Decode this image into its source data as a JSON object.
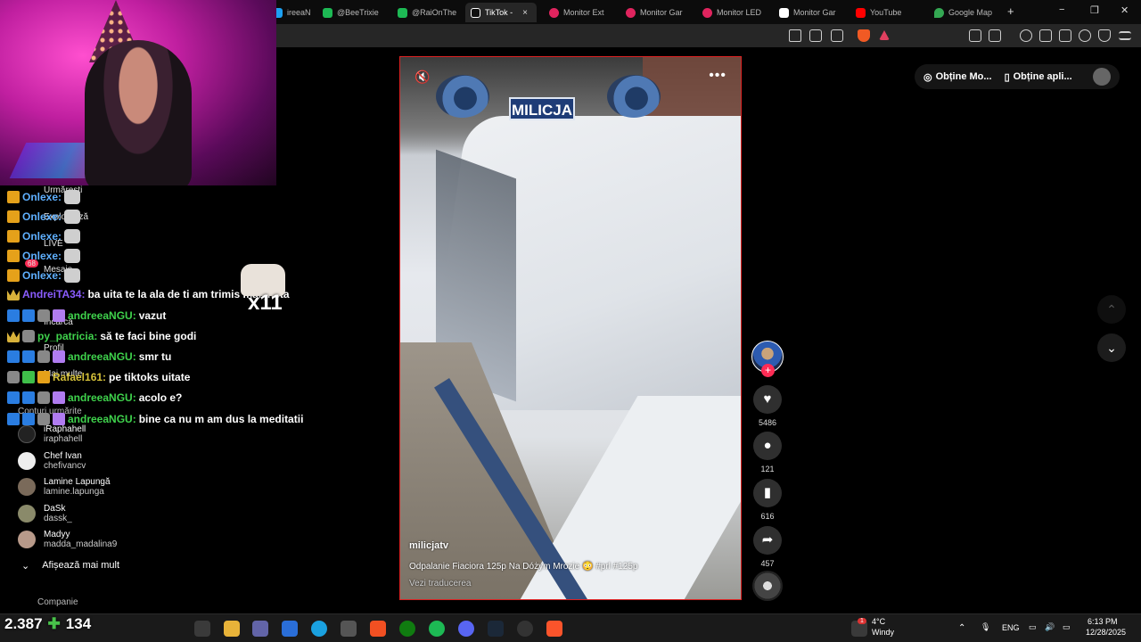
{
  "browser": {
    "tabs": [
      {
        "label": "ireeaN",
        "color": "#1da1f2"
      },
      {
        "label": "@BeeTrixie",
        "color": "#1db954"
      },
      {
        "label": "@RaiOnThe",
        "color": "#1db954"
      },
      {
        "label": "TikTok -",
        "color": "#111111",
        "active": true
      },
      {
        "label": "Monitor Ext",
        "color": "#e0245e"
      },
      {
        "label": "Monitor Gar",
        "color": "#e0245e"
      },
      {
        "label": "Monitor LED",
        "color": "#e0245e"
      },
      {
        "label": "Monitor Gar",
        "color": "#ffffff"
      },
      {
        "label": "YouTube",
        "color": "#ff0000"
      },
      {
        "label": "Google Map",
        "color": "#34a853"
      }
    ],
    "new_tab": "+",
    "close_tab": "×",
    "minimize": "−",
    "maximize": "❐",
    "close": "✕"
  },
  "sidebar": {
    "items": [
      "Urmărești",
      "Explorează",
      "LIVE",
      "Mesaje",
      "Încarcă",
      "Profil",
      "Mai multe"
    ],
    "messages_badge": "68",
    "following_header": "Conturi urmărite",
    "accounts": [
      {
        "display": "iRaphahell",
        "handle": "iraphahell"
      },
      {
        "display": "Chef Ivan",
        "handle": "chefivancv"
      },
      {
        "display": "Lamine Lapungă",
        "handle": "lamine.lapunga"
      },
      {
        "display": "DaSk",
        "handle": "dassk_"
      },
      {
        "display": "Madyy",
        "handle": "madda_madalina9"
      }
    ],
    "show_more": "Afișează mai mult",
    "company": "Companie"
  },
  "chat": {
    "lines": [
      {
        "user": "Onlexe:",
        "color": "#5fb0ff",
        "text": ""
      },
      {
        "user": "Onlexe:",
        "color": "#5fb0ff",
        "text": ""
      },
      {
        "user": "Onlexe:",
        "color": "#5fb0ff",
        "text": ""
      },
      {
        "user": "Onlexe:",
        "color": "#5fb0ff",
        "text": ""
      },
      {
        "user": "Onlexe:",
        "color": "#5fb0ff",
        "text": ""
      },
      {
        "user": "AndreiTA34:",
        "color": "#8a5cff",
        "text": "ba uita te la ala de ti am trimis mai jnsta"
      },
      {
        "user": "andreeaNGU:",
        "color": "#3fd24c",
        "text": "vazut"
      },
      {
        "user": "py_patricia:",
        "color": "#3fd24c",
        "text": "să te faci bine godi"
      },
      {
        "user": "andreeaNGU:",
        "color": "#3fd24c",
        "text": "smr tu"
      },
      {
        "user": "Rafael161:",
        "color": "#d6c23a",
        "text": "pe tiktoks uitate"
      },
      {
        "user": "andreeaNGU:",
        "color": "#3fd24c",
        "text": "acolo e?"
      },
      {
        "user": "andreeaNGU:",
        "color": "#3fd24c",
        "text": "bine ca nu m am dus la meditatii"
      }
    ],
    "emote_combo": "x11"
  },
  "video": {
    "sign_text": "MILICJA",
    "author": "milicjatv",
    "caption": "Odpalanie Fiaciora 125p Na Dóżym Mrozie 😳 #prl #125p",
    "translate": "Vezi traducerea",
    "mute_icon": "🔇",
    "more_icon": "•••"
  },
  "actions": {
    "likes": "5486",
    "comments": "121",
    "saves": "616",
    "shares": "457"
  },
  "top_right": {
    "get_coins": "Obține Mo...",
    "get_app": "Obține apli..."
  },
  "overlay": {
    "viewers": "2.387",
    "followers": "134"
  },
  "taskbar": {
    "weather_temp": "4°C",
    "weather_desc": "Windy",
    "lang": "ENG",
    "time": "6:13 PM",
    "date": "12/28/2025",
    "weather_badge": "1"
  }
}
